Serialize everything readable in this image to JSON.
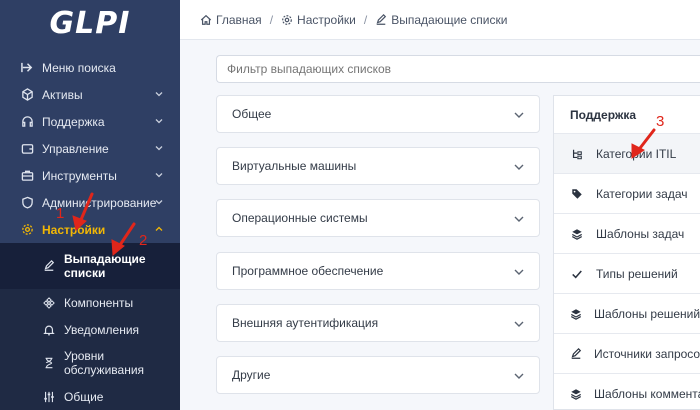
{
  "sidebar": {
    "logo": "GLPI",
    "items": [
      {
        "label": "Меню поиска",
        "icon": "search-menu-icon"
      },
      {
        "label": "Активы",
        "icon": "assets-icon"
      },
      {
        "label": "Поддержка",
        "icon": "headset-icon"
      },
      {
        "label": "Управление",
        "icon": "wallet-icon"
      },
      {
        "label": "Инструменты",
        "icon": "briefcase-icon"
      },
      {
        "label": "Администрирование",
        "icon": "shield-icon"
      },
      {
        "label": "Настройки",
        "icon": "gear-icon"
      }
    ],
    "submenu": [
      {
        "label": "Выпадающие списки",
        "line1": "Выпадающие",
        "line2": "списки"
      },
      {
        "label": "Компоненты"
      },
      {
        "label": "Уведомления"
      },
      {
        "label": "Уровни обслуживания",
        "line1": "Уровни",
        "line2": "обслуживания"
      },
      {
        "label": "Общие"
      }
    ]
  },
  "breadcrumb": {
    "home": "Главная",
    "settings": "Настройки",
    "dropdowns": "Выпадающие списки"
  },
  "filter": {
    "placeholder": "Фильтр выпадающих списков"
  },
  "sections": [
    "Общее",
    "Виртуальные машины",
    "Операционные системы",
    "Программное обеспечение",
    "Внешняя аутентификация",
    "Другие"
  ],
  "panel": {
    "title": "Поддержка",
    "items": [
      "Категории ITIL",
      "Категории задач",
      "Шаблоны задач",
      "Типы решений",
      "Шаблоны решений",
      "Источники запросов",
      "Шаблоны комментариев"
    ]
  },
  "annotations": [
    "1",
    "2",
    "3"
  ],
  "colors": {
    "sidebar": "#2f3f64",
    "active": "#f2b705",
    "annotation": "#e0261b"
  }
}
